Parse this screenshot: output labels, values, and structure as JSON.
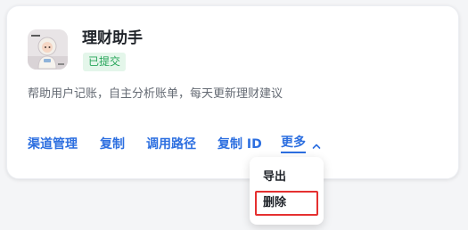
{
  "app": {
    "title": "理财助手",
    "status_badge": "已提交",
    "description": "帮助用户记账，自主分析账单，每天更新理财建议",
    "avatar_icon": "cartoon-astronaut-avatar"
  },
  "actions": {
    "channel_manage": "渠道管理",
    "copy": "复制",
    "call_path": "调用路径",
    "copy_id": "复制 ID",
    "more": "更多"
  },
  "more_menu": {
    "items": [
      "导出",
      "删除"
    ]
  },
  "colors": {
    "accent": "#2d6fe0",
    "badge_bg": "#e4f6ea",
    "badge_text": "#27a55a",
    "highlight_border": "#e53030"
  }
}
